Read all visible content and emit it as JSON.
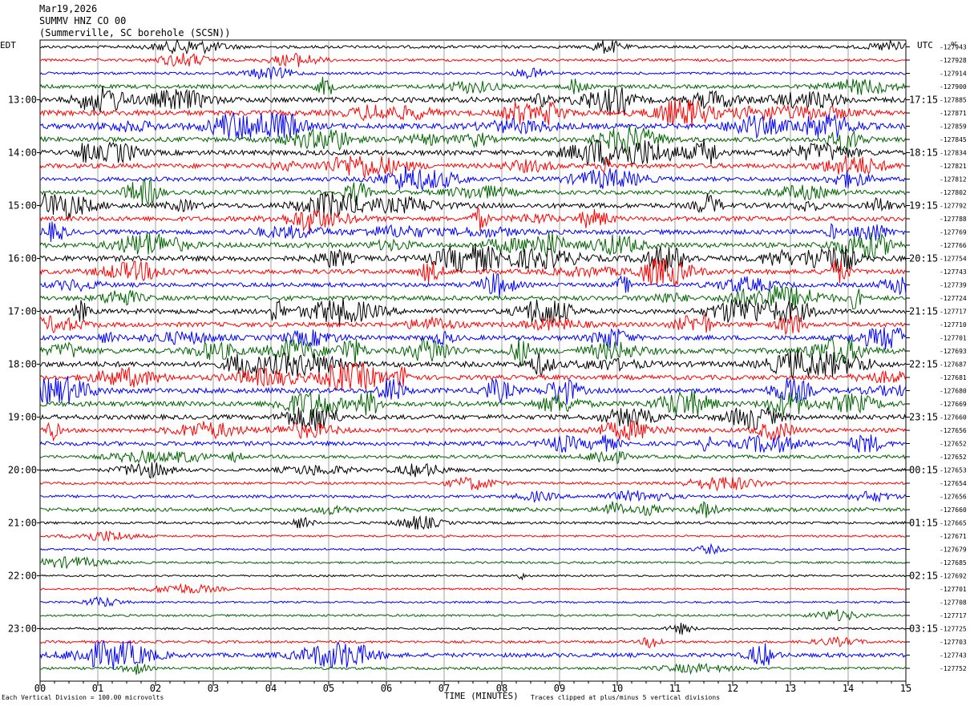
{
  "header": {
    "date": "Mar19,2026",
    "channel": "SUMMV HNZ CO 00",
    "station": "(Summerville, SC borehole (SCSN))"
  },
  "axes": {
    "left_label": "EDT",
    "right_label": "UTC",
    "x_title": "TIME (MINUTES)"
  },
  "footer": {
    "division_note": "Each Vertical Division = 100.00 microvolts",
    "clip_note": "Traces clipped at plus/minus 5 vertical divisions"
  },
  "colors": {
    "trace_cycle": [
      "#000000",
      "#ff0000",
      "#0000ff",
      "#006400"
    ],
    "grid": "#a0a0a0"
  },
  "chart_data": {
    "type": "line",
    "title": "",
    "x_ticks": [
      "00",
      "01",
      "02",
      "03",
      "04",
      "05",
      "06",
      "07",
      "08",
      "09",
      "10",
      "11",
      "12",
      "13",
      "14",
      "15"
    ],
    "xlim": [
      0,
      15
    ],
    "left_hour_labels": [
      "13:00",
      "14:00",
      "15:00",
      "16:00",
      "17:00",
      "18:00",
      "19:00",
      "20:00",
      "21:00",
      "22:00",
      "23:00"
    ],
    "right_hour_labels": [
      "17:15",
      "18:15",
      "19:15",
      "20:15",
      "21:15",
      "22:15",
      "23:15",
      "00:15",
      "01:15",
      "02:15",
      "03:15"
    ],
    "right_first_tick_small": "0C",
    "trace_offsets": [
      -127943,
      -127928,
      -127914,
      -127900,
      -127885,
      -127871,
      -127859,
      -127845,
      -127834,
      -127821,
      -127812,
      -127802,
      -127792,
      -127788,
      -127769,
      -127766,
      -127754,
      -127743,
      -127739,
      -127724,
      -127717,
      -127710,
      -127701,
      -127693,
      -127687,
      -127681,
      -127680,
      -127669,
      -127660,
      -127656,
      -127652,
      -127652,
      -127653,
      -127654,
      -127656,
      -127660,
      -127665,
      -127671,
      -127679,
      -127685,
      -127692,
      -127701,
      -127708,
      -127717,
      -127725,
      -127703,
      -127743,
      -127752
    ],
    "trace_activity": [
      0.4,
      0.3,
      0.3,
      0.6,
      1.0,
      1.0,
      1.0,
      0.8,
      0.9,
      0.8,
      0.7,
      0.7,
      0.9,
      0.8,
      0.8,
      0.9,
      1.0,
      0.8,
      0.7,
      0.8,
      0.9,
      0.8,
      0.8,
      1.0,
      1.0,
      0.8,
      0.9,
      0.9,
      0.8,
      0.7,
      0.7,
      0.5,
      0.4,
      0.3,
      0.4,
      0.6,
      0.3,
      0.2,
      0.2,
      0.2,
      0.15,
      0.15,
      0.15,
      0.2,
      0.2,
      0.3,
      0.7,
      0.3
    ]
  }
}
